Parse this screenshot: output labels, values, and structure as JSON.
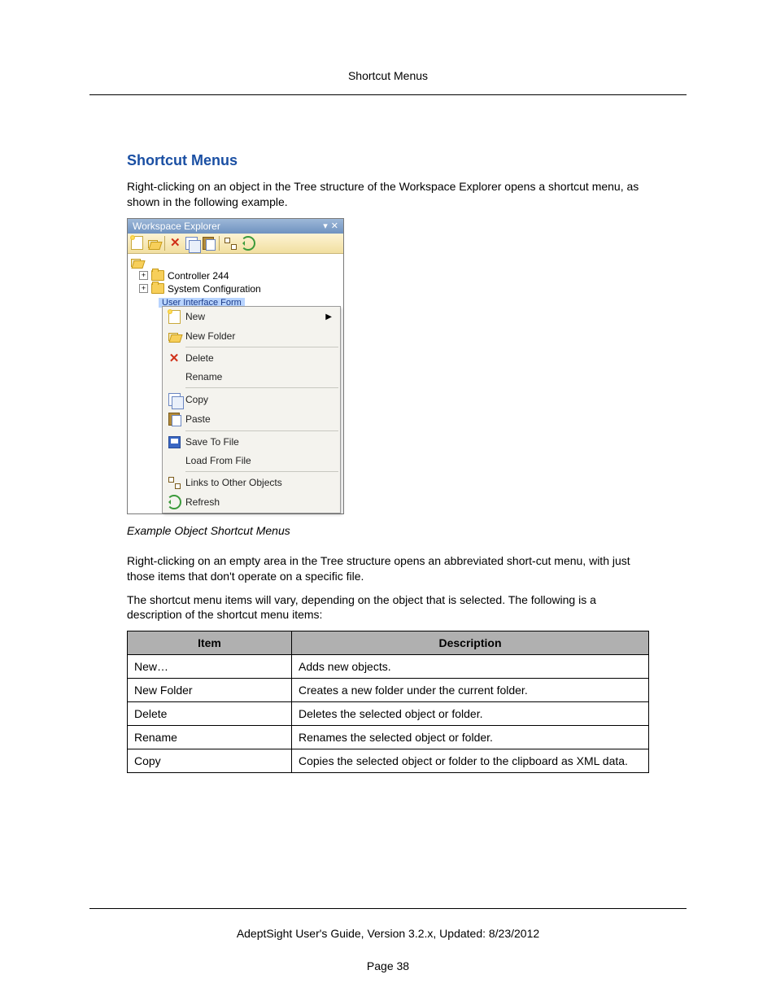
{
  "header": {
    "title": "Shortcut Menus"
  },
  "section": {
    "heading": "Shortcut Menus",
    "intro": "Right-clicking on an object in the Tree structure of the Workspace Explorer opens a shortcut menu, as shown in the following example.",
    "caption": "Example Object Shortcut Menus",
    "para2": "Right-clicking on an empty area in the Tree structure opens an abbreviated short-cut menu, with just those items that don't operate on a specific file.",
    "para3": "The shortcut menu items will vary, depending on the object that is selected. The following is a description of the shortcut menu items:"
  },
  "explorer": {
    "title": "Workspace Explorer",
    "tree": {
      "node1": "Controller 244",
      "node2": "System Configuration",
      "selected": "User Interface Form"
    }
  },
  "context_menu": {
    "items": [
      {
        "label": "New",
        "icon": "new",
        "has_submenu": true
      },
      {
        "label": "New Folder",
        "icon": "open"
      },
      {
        "sep": true
      },
      {
        "label": "Delete",
        "icon": "del"
      },
      {
        "label": "Rename",
        "icon": ""
      },
      {
        "sep": true
      },
      {
        "label": "Copy",
        "icon": "copy"
      },
      {
        "label": "Paste",
        "icon": "paste"
      },
      {
        "sep": true
      },
      {
        "label": "Save To File",
        "icon": "save"
      },
      {
        "label": "Load From File",
        "icon": ""
      },
      {
        "sep": true
      },
      {
        "label": "Links to Other Objects",
        "icon": "links"
      },
      {
        "label": "Refresh",
        "icon": "refresh"
      }
    ]
  },
  "table": {
    "head_item": "Item",
    "head_desc": "Description",
    "rows": [
      {
        "item": "New…",
        "desc": "Adds new objects."
      },
      {
        "item": "New Folder",
        "desc": "Creates a new folder under the current folder."
      },
      {
        "item": "Delete",
        "desc": "Deletes the selected object or folder."
      },
      {
        "item": "Rename",
        "desc": "Renames the selected object or folder."
      },
      {
        "item": "Copy",
        "desc": "Copies the selected object or folder to the clipboard as XML data."
      }
    ]
  },
  "footer": {
    "line1": "AdeptSight User's Guide,  Version 3.2.x, Updated: 8/23/2012",
    "page": "Page 38"
  }
}
